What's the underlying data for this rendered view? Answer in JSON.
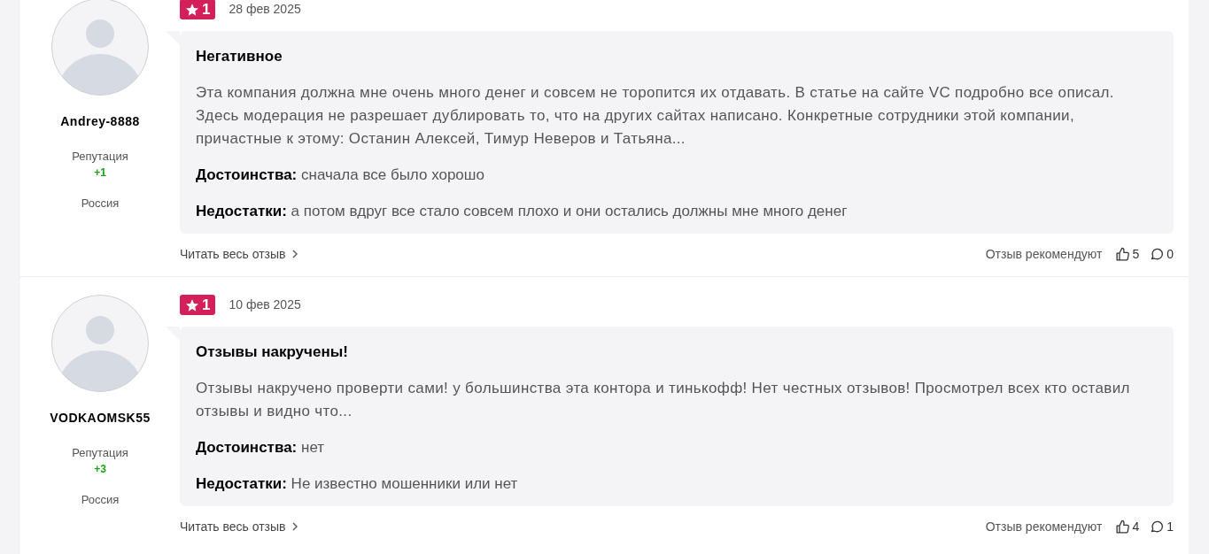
{
  "reviews": [
    {
      "author": "Andrey-8888",
      "reputation_label": "Репутация",
      "reputation": "+1",
      "country": "Россия",
      "rating": "1",
      "date": "28 фев 2025",
      "title": "Негативное",
      "text": "Эта компания должна мне очень много денег и совсем не торопится их отдавать. В статье на сайте VC подробно все описал. Здесь модерация не разрешает дублировать то, что на других сайтах написано. Конкретные сотрудники этой компании, причастные к этому: Останин Алексей, Тимур Неверов и Татьяна...",
      "pros_label": "Достоинства:",
      "pros": "сначала все было хорошо",
      "cons_label": "Недостатки:",
      "cons": "а потом вдруг все стало совсем плохо и они остались должны мне много денег",
      "read_more": "Читать весь отзыв",
      "recommend_label": "Отзыв рекомендуют",
      "likes": "5",
      "comments": "0"
    },
    {
      "author": "VODKAOMSK55",
      "reputation_label": "Репутация",
      "reputation": "+3",
      "country": "Россия",
      "rating": "1",
      "date": "10 фев 2025",
      "title": "Отзывы накручены!",
      "text": "Отзывы накручено проверти сами! у большинства эта контора и тинькофф! Нет честных отзывов! Просмотрел всех кто оставил отзывы и видно что...",
      "pros_label": "Достоинства:",
      "pros": "нет",
      "cons_label": "Недостатки:",
      "cons": "Не известно мошенники или нет",
      "read_more": "Читать весь отзыв",
      "recommend_label": "Отзыв рекомендуют",
      "likes": "4",
      "comments": "1"
    }
  ]
}
